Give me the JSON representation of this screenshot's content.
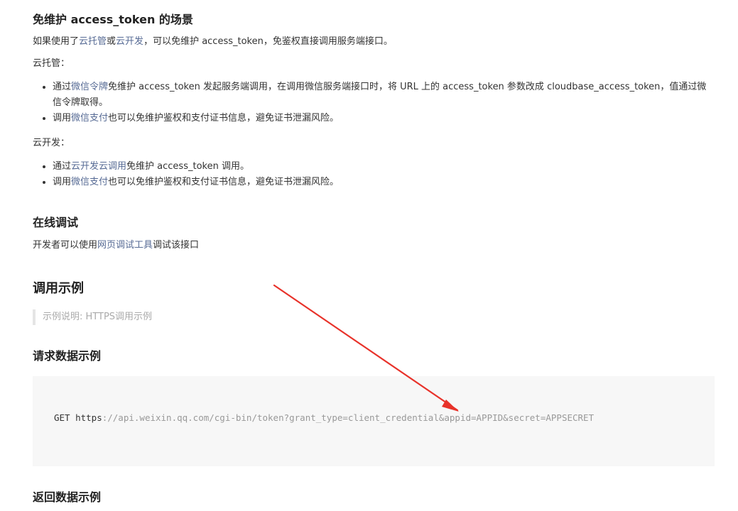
{
  "section_maintenance": {
    "title": "免维护 access_token 的场景",
    "intro_pre": "如果使用了",
    "link_cloudhosting": "云托管",
    "intro_or": "或",
    "link_clouddev": "云开发",
    "intro_post": "，可以免维护 access_token，免鉴权直接调用服务端接口。",
    "cloudhosting_label": "云托管：",
    "cloudhosting_items": [
      {
        "pre": "通过",
        "link": "微信令牌",
        "post": "免维护 access_token 发起服务端调用，在调用微信服务端接口时，将 URL 上的 access_token 参数改成 cloudbase_access_token，值通过微信令牌取得。"
      },
      {
        "pre": "调用",
        "link": "微信支付",
        "post": "也可以免维护鉴权和支付证书信息，避免证书泄漏风险。"
      }
    ],
    "clouddev_label": "云开发：",
    "clouddev_items": [
      {
        "pre": "通过",
        "link": "云开发云调用",
        "post": "免维护 access_token 调用。"
      },
      {
        "pre": "调用",
        "link": "微信支付",
        "post": "也可以免维护鉴权和支付证书信息，避免证书泄漏风险。"
      }
    ]
  },
  "section_debug": {
    "title": "在线调试",
    "text_pre": "开发者可以使用",
    "link": "网页调试工具",
    "text_post": "调试该接口"
  },
  "section_example": {
    "title": "调用示例",
    "note": "示例说明: HTTPS调用示例"
  },
  "section_request": {
    "title": "请求数据示例",
    "code_method": "GET https",
    "code_rest": "://api.weixin.qq.com/cgi-bin/token?grant_type=client_credential&appid=APPID&secret=APPSECRET"
  },
  "section_response": {
    "title": "返回数据示例"
  },
  "colors": {
    "link": "#576b95",
    "arrow": "#e8322a",
    "code_bg": "#f7f7f7"
  }
}
